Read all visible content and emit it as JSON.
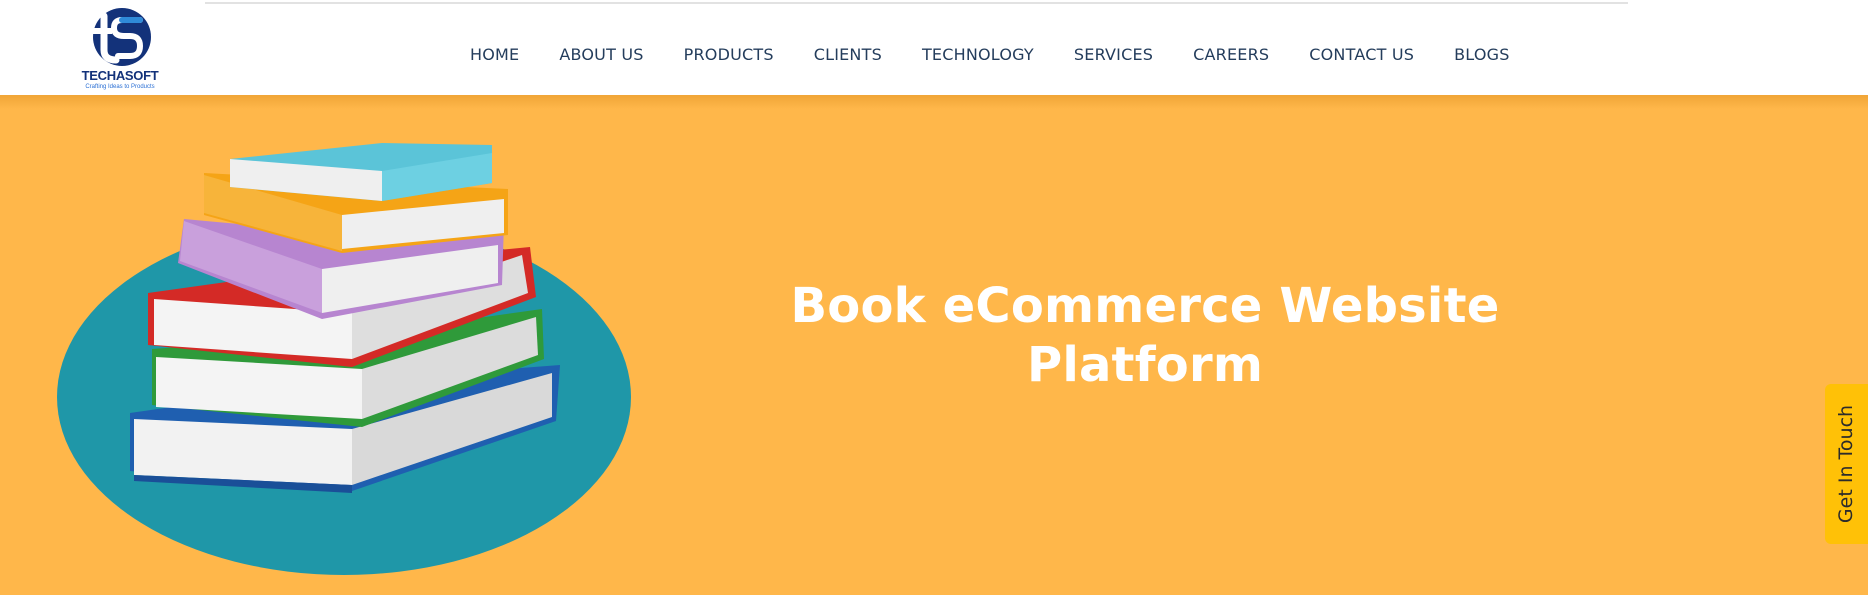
{
  "brand": {
    "name": "TECHASOFT",
    "tagline": "Crafting Ideas to Products"
  },
  "nav": {
    "items": [
      {
        "label": "HOME"
      },
      {
        "label": "ABOUT US"
      },
      {
        "label": "PRODUCTS"
      },
      {
        "label": "CLIENTS"
      },
      {
        "label": "TECHNOLOGY"
      },
      {
        "label": "SERVICES"
      },
      {
        "label": "CAREERS"
      },
      {
        "label": "CONTACT US"
      },
      {
        "label": "BLOGS"
      }
    ]
  },
  "hero": {
    "title_line1": "Book eCommerce Website",
    "title_line2": "Platform",
    "illustration": "stack-of-books-icon"
  },
  "floating": {
    "get_in_touch": "Get In Touch"
  },
  "colors": {
    "hero_background": "#ffb74a",
    "nav_text": "#243d5c",
    "logo_blue": "#13327a",
    "teal_ellipse": "#1f97a8",
    "cta_background": "#ffc107"
  }
}
